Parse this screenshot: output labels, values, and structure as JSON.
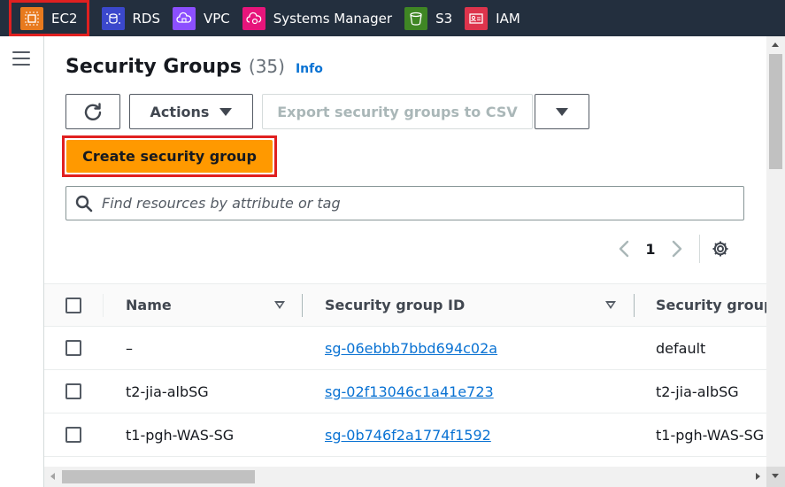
{
  "colors": {
    "topbar_bg": "#232f3e",
    "ec2_icon": "#e87a1e",
    "rds_icon": "#3b48cc",
    "vpc_icon": "#8c4fff",
    "ssm_icon": "#e7157b",
    "s3_icon": "#3f8624",
    "iam_icon": "#dd344c",
    "primary_button": "#ff9900",
    "link": "#0972d3",
    "highlight_border": "#e02020"
  },
  "topbar": {
    "services": [
      {
        "label": "EC2",
        "icon": "ec2-icon"
      },
      {
        "label": "RDS",
        "icon": "rds-icon"
      },
      {
        "label": "VPC",
        "icon": "vpc-icon"
      },
      {
        "label": "Systems Manager",
        "icon": "systems-manager-icon"
      },
      {
        "label": "S3",
        "icon": "s3-icon"
      },
      {
        "label": "IAM",
        "icon": "iam-icon"
      }
    ]
  },
  "header": {
    "title": "Security Groups",
    "count": "(35)",
    "info": "Info"
  },
  "toolbar": {
    "actions_label": "Actions",
    "export_label": "Export security groups to CSV",
    "create_label": "Create security group"
  },
  "search": {
    "placeholder": "Find resources by attribute or tag"
  },
  "pagination": {
    "current_page": "1"
  },
  "table": {
    "columns": [
      "Name",
      "Security group ID",
      "Security group"
    ],
    "rows": [
      {
        "name": "–",
        "id": "sg-06ebbb7bbd694c02a",
        "group_name": "default"
      },
      {
        "name": "t2-jia-albSG",
        "id": "sg-02f13046c1a41e723",
        "group_name": "t2-jia-albSG"
      },
      {
        "name": "t1-pgh-WAS-SG",
        "id": "sg-0b746f2a1774f1592",
        "group_name": "t1-pgh-WAS-SG"
      }
    ]
  }
}
